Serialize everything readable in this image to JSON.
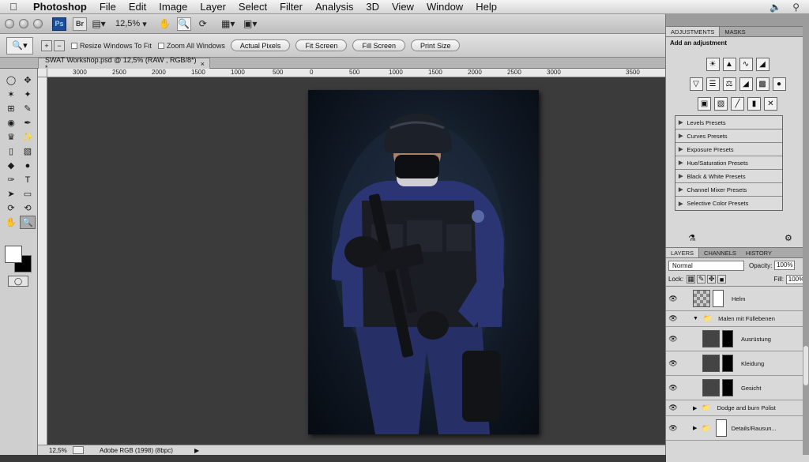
{
  "menubar": {
    "app": "Photoshop",
    "items": [
      "File",
      "Edit",
      "Image",
      "Layer",
      "Select",
      "Filter",
      "Analysis",
      "3D",
      "View",
      "Window",
      "Help"
    ]
  },
  "appbar": {
    "ps_badge": "Ps",
    "br_badge": "Br",
    "zoom": "12,5%"
  },
  "options": {
    "checkbox_resize": "Resize Windows To Fit",
    "checkbox_zoom_all": "Zoom All Windows",
    "buttons": [
      "Actual Pixels",
      "Fit Screen",
      "Fill Screen",
      "Print Size"
    ]
  },
  "document": {
    "tab_title": "SWAT Workshop.psd @ 12,5% (RAW , RGB/8*) *"
  },
  "ruler": {
    "ticks": [
      "3000",
      "2500",
      "2000",
      "1500",
      "1000",
      "500",
      "0",
      "500",
      "1000",
      "1500",
      "2000",
      "2500",
      "3000",
      "3500"
    ]
  },
  "status": {
    "zoom": "12,5%",
    "profile": "Adobe RGB (1998) (8bpc)"
  },
  "adjustments": {
    "tabs": [
      "ADJUSTMENTS",
      "MASKS"
    ],
    "title": "Add an adjustment",
    "presets": [
      "Levels Presets",
      "Curves Presets",
      "Exposure Presets",
      "Hue/Saturation Presets",
      "Black & White Presets",
      "Channel Mixer Presets",
      "Selective Color Presets"
    ]
  },
  "layers": {
    "tabs": [
      "LAYERS",
      "CHANNELS",
      "HISTORY"
    ],
    "blend_mode": "Normal",
    "opacity_label": "Opacity:",
    "opacity": "100%",
    "lock_label": "Lock:",
    "fill_label": "Fill:",
    "fill": "100%",
    "rows": [
      "Helm",
      "Malen mit Füllebenen",
      "Ausrüstung",
      "Kleidung",
      "Gesicht",
      "Dodge and burn Polist",
      "Details/Rausun..."
    ]
  }
}
